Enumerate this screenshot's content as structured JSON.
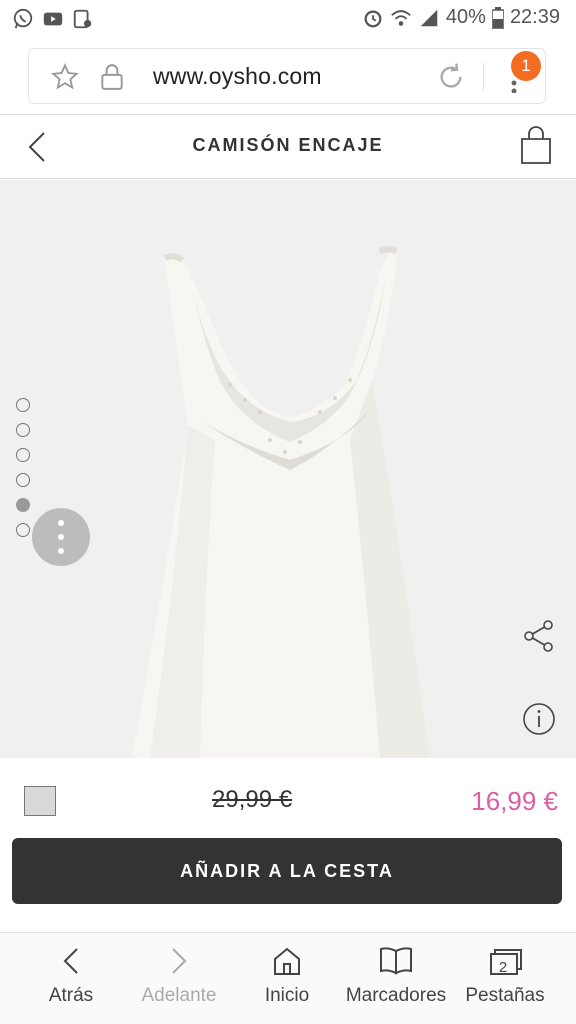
{
  "status_bar": {
    "battery": "40%",
    "time": "22:39"
  },
  "browser": {
    "url": "www.oysho.com",
    "tab_badge": "1"
  },
  "header": {
    "title": "CAMISÓN ENCAJE"
  },
  "gallery": {
    "total_images": 6,
    "active_index": 5
  },
  "product": {
    "old_price": "29,99 €",
    "new_price": "16,99 €",
    "swatch_color": "#d9d9d9"
  },
  "cta": {
    "add_to_basket": "AÑADIR A LA CESTA"
  },
  "bottom_nav": {
    "back": "Atrás",
    "forward": "Adelante",
    "home": "Inicio",
    "bookmarks": "Marcadores",
    "tabs": "Pestañas",
    "tabs_count": "2"
  },
  "colors": {
    "accent_price": "#d860a6",
    "badge": "#f26d21",
    "button_dark": "#333333"
  }
}
